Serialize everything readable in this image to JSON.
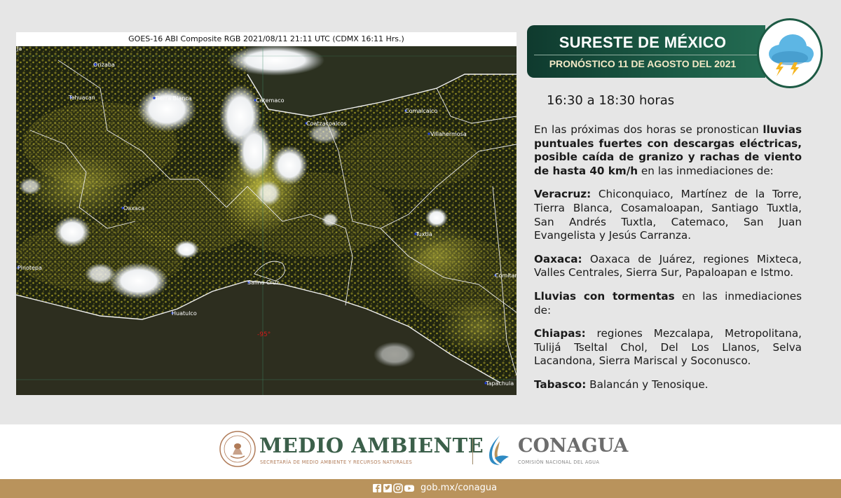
{
  "satellite": {
    "caption": "GOES-16 ABI Composite RGB 2021/08/11 21:11 UTC (CDMX  16:11 Hrs.)",
    "cities": [
      "Orizaba",
      "Tehuacan",
      "Tierra Blanca",
      "Catemaco",
      "Coatzacoalcos",
      "Comalcalco",
      "Villahermosa",
      "Oaxaca",
      "Tuxtla",
      "Pinotepa",
      "Salina Cruz",
      "Huatulco",
      "Comitan",
      "Tapachula",
      "Ja"
    ],
    "longitude_label": "-95°"
  },
  "header": {
    "title": "SURESTE DE MÉXICO",
    "subtitle": "PRONÓSTICO 11 DE AGOSTO DEL 2021",
    "icon": "storm-cloud-lightning-icon"
  },
  "forecast": {
    "time_range": "16:30 a 18:30 horas",
    "intro_pre": "En las próximas dos horas se pronostican ",
    "intro_bold": "lluvias puntuales fuertes con descargas eléctricas, posible caída de granizo y rachas de viento de hasta 40 km/h",
    "intro_post": " en las inmediaciones de:",
    "veracruz_label": "Veracruz:",
    "veracruz_text": " Chiconquiaco, Martínez de la Torre, Tierra Blanca, Cosamaloapan, Santiago Tuxtla, San Andrés Tuxtla, Catemaco, San Juan Evangelista y Jesús Carranza.",
    "oaxaca_label": "Oaxaca:",
    "oaxaca_text": " Oaxaca de Juárez, regiones Mixteca, Valles Centrales, Sierra Sur, Papaloapan e Istmo.",
    "tormentas_bold": "Lluvias con tormentas",
    "tormentas_text": " en las inmediaciones de:",
    "chiapas_label": "Chiapas:",
    "chiapas_text": " regiones Mezcalapa, Metropolitana, Tulijá Tseltal Chol, Del Los Llanos, Selva Lacandona, Sierra Mariscal y Soconusco.",
    "tabasco_label": "Tabasco:",
    "tabasco_text": " Balancán y Tenosique."
  },
  "footer": {
    "medio_ambiente_title": "MEDIO AMBIENTE",
    "medio_ambiente_sub": "SECRETARÍA DE MEDIO AMBIENTE Y RECURSOS NATURALES",
    "seal_text": "ESTADOS UNIDOS MEXICANOS",
    "conagua_title": "CONAGUA",
    "conagua_sub": "COMISIÓN NACIONAL DEL AGUA",
    "url": "gob.mx/conagua",
    "social_icons": [
      "facebook-icon",
      "twitter-icon",
      "instagram-icon",
      "youtube-icon"
    ],
    "colors": {
      "green": "#1b5a45",
      "gold": "#b9935c",
      "cream": "#f3e9c6"
    }
  }
}
